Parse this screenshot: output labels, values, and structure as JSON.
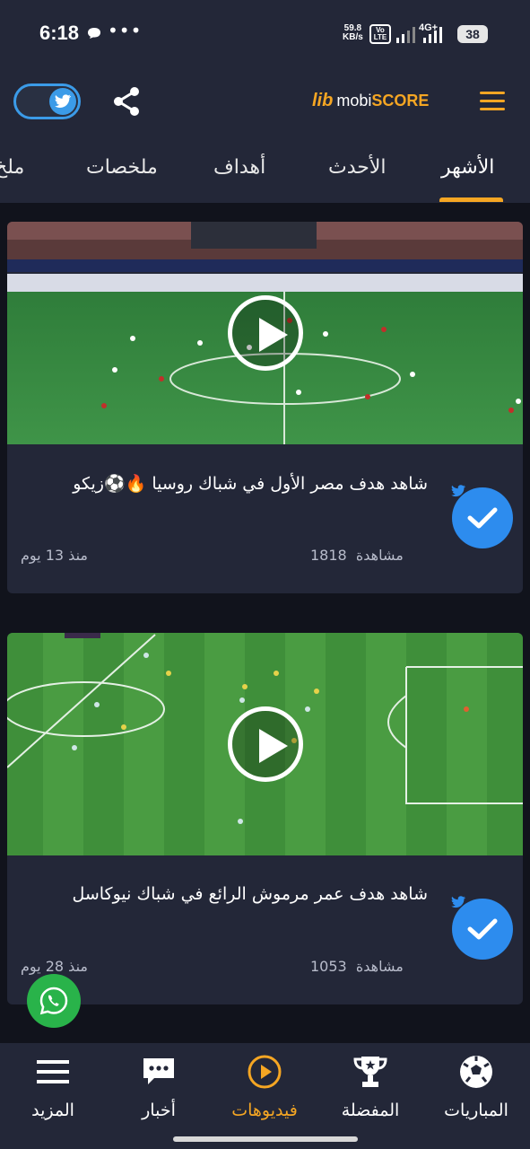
{
  "status": {
    "time": "6:18",
    "net_speed": "59.8",
    "net_unit": "KB/s",
    "volte": "Vo LTE",
    "network": "4G+",
    "battery": "38"
  },
  "header": {
    "logo_mark": "lib",
    "logo_mobi": "mobi",
    "logo_score": "SCORE",
    "brand_color": "#f5a623"
  },
  "tabs": [
    {
      "label": "الأشهر",
      "active": true
    },
    {
      "label": "الأحدث",
      "active": false
    },
    {
      "label": "أهداف",
      "active": false
    },
    {
      "label": "ملخصات",
      "active": false
    },
    {
      "label": "ملخ",
      "active": false
    }
  ],
  "videos": [
    {
      "title": "شاهد هدف مصر الأول في شباك روسيا 🔥⚽زيكو",
      "views_count": "1818",
      "views_label": "مشاهدة",
      "ago": "منذ 13 يوم"
    },
    {
      "title": "شاهد هدف عمر مرموش الرائع في شباك نيوكاسل",
      "views_count": "1053",
      "views_label": "مشاهدة",
      "ago": "منذ 28 يوم"
    }
  ],
  "bottom_nav": [
    {
      "label": "المزيد",
      "icon": "menu-icon"
    },
    {
      "label": "أخبار",
      "icon": "chat-icon"
    },
    {
      "label": "فيديوهات",
      "icon": "play-circle-icon",
      "active": true
    },
    {
      "label": "المفضلة",
      "icon": "trophy-icon"
    },
    {
      "label": "المباريات",
      "icon": "football-icon"
    }
  ]
}
